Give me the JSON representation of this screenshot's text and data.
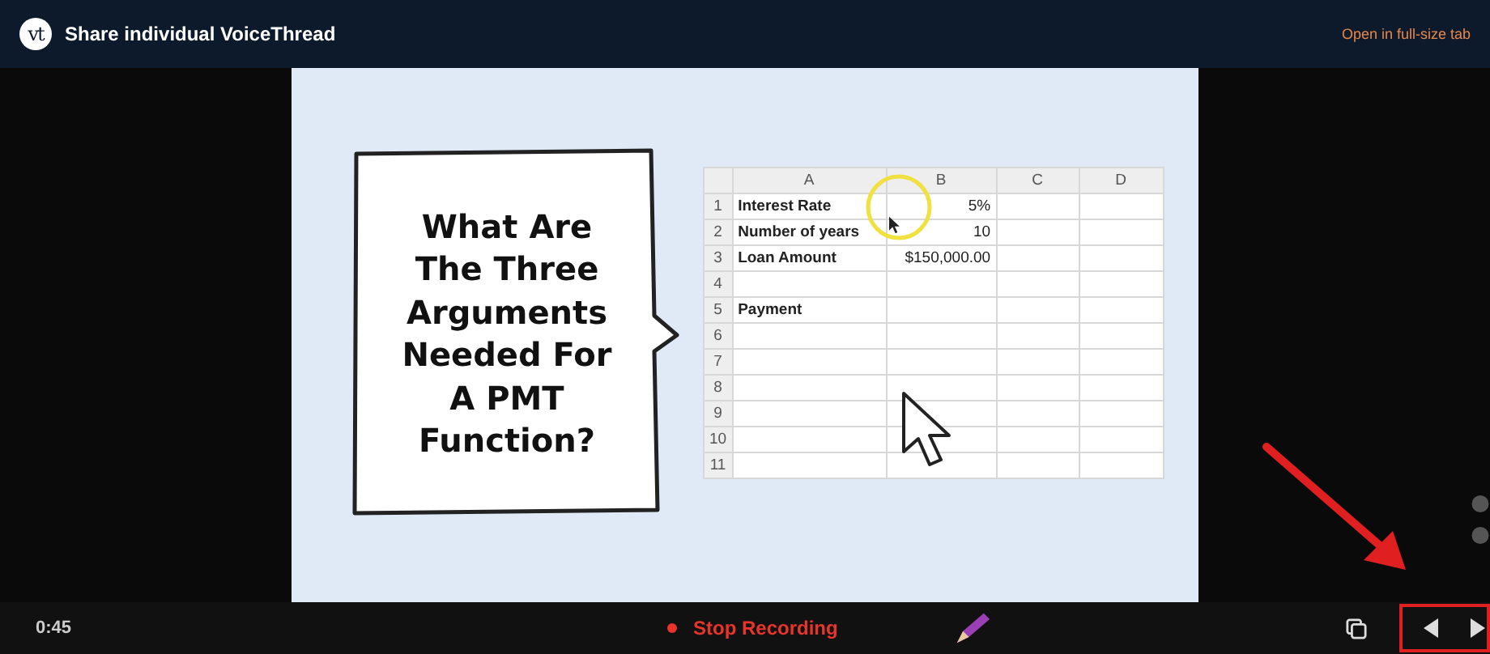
{
  "header": {
    "logo": "vt",
    "title": "Share individual VoiceThread",
    "link": "Open in full-size tab"
  },
  "slide": {
    "question": "What Are The Three Arguments Needed For A PMT Function?",
    "sheet": {
      "columns": [
        "A",
        "B",
        "C",
        "D"
      ],
      "rows": [
        {
          "number": "1",
          "cells": [
            "Interest Rate",
            "5%"
          ]
        },
        {
          "number": "2",
          "cells": [
            "Number of years",
            "10"
          ]
        },
        {
          "number": "3",
          "cells": [
            "Loan Amount",
            "$150,000.00"
          ]
        },
        {
          "number": "4"
        },
        {
          "number": "5",
          "cells": [
            "Payment"
          ]
        },
        {
          "number": "6"
        },
        {
          "number": "7"
        },
        {
          "number": "8"
        },
        {
          "number": "9"
        },
        {
          "number": "10"
        },
        {
          "number": "11"
        }
      ]
    }
  },
  "footer": {
    "time": "0:45",
    "record_label": "Stop Recording"
  }
}
